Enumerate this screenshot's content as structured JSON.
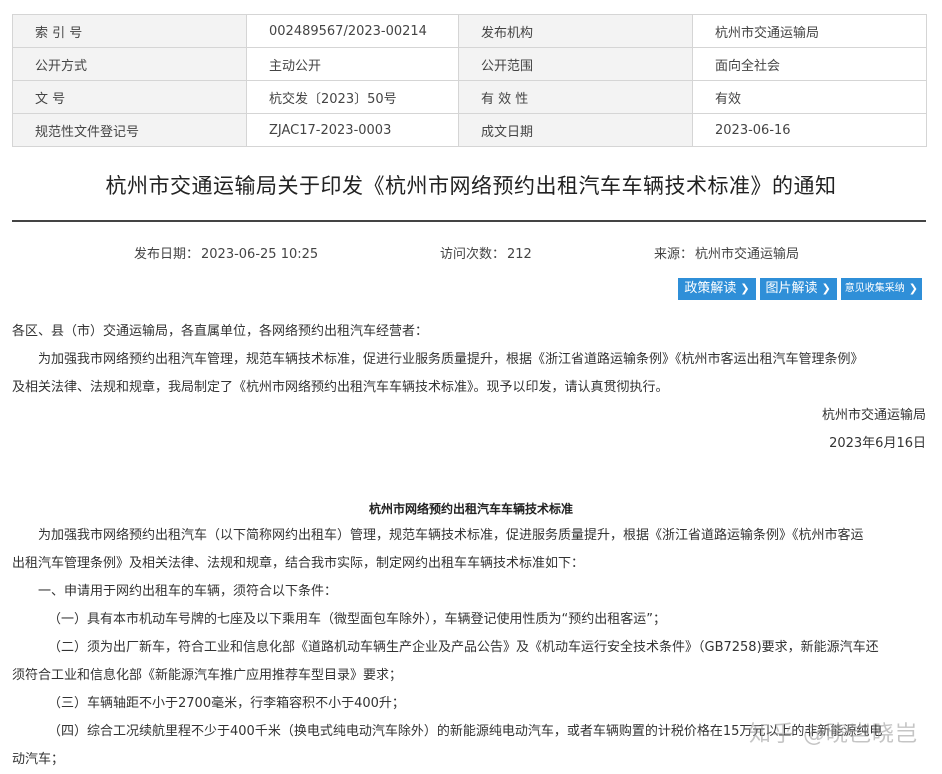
{
  "meta": {
    "rows": [
      [
        "索 引 号",
        "002489567/2023-00214",
        "发布机构",
        "杭州市交通运输局"
      ],
      [
        "公开方式",
        "主动公开",
        "公开范围",
        "面向全社会"
      ],
      [
        "文  号",
        "杭交发〔2023〕50号",
        "有 效 性",
        "有效"
      ],
      [
        "规范性文件登记号",
        "ZJAC17-2023-0003",
        "成文日期",
        "2023-06-16"
      ]
    ]
  },
  "article": {
    "title": "杭州市交通运输局关于印发《杭州市网络预约出租汽车车辆技术标准》的通知",
    "publish_label": "发布日期：",
    "publish_date": "2023-06-25 10:25",
    "visits_label": "访问次数：",
    "visits": "212",
    "source_label": "来源：",
    "source": "杭州市交通运输局"
  },
  "buttons": {
    "policy": "政策解读",
    "image": "图片解读",
    "feedback": "意见收集采纳"
  },
  "notice": {
    "salutation": "各区、县（市）交通运输局，各直属单位，各网络预约出租汽车经营者：",
    "line1": "为加强我市网络预约出租汽车管理，规范车辆技术标准，促进行业服务质量提升，根据《浙江省道路运输条例》《杭州市客运出租汽车管理条例》",
    "line2": "及相关法律、法规和规章，我局制定了《杭州市网络预约出租汽车车辆技术标准》。现予以印发，请认真贯彻执行。",
    "signature": "杭州市交通运输局",
    "date": "2023年6月16日"
  },
  "standard": {
    "title": "杭州市网络预约出租汽车车辆技术标准",
    "lines": [
      "为加强我市网络预约出租汽车（以下简称网约出租车）管理，规范车辆技术标准，促进服务质量提升，根据《浙江省道路运输条例》《杭州市客运",
      "出租汽车管理条例》及相关法律、法规和规章，结合我市实际，制定网约出租车车辆技术标准如下：",
      "一、申请用于网约出租车的车辆，须符合以下条件：",
      "（一）具有本市机动车号牌的七座及以下乘用车（微型面包车除外），车辆登记使用性质为“预约出租客运”；",
      "（二）须为出厂新车，符合工业和信息化部《道路机动车辆生产企业及产品公告》及《机动车运行安全技术条件》（GB7258)要求，新能源汽车还",
      "须符合工业和信息化部《新能源汽车推广应用推荐车型目录》要求；",
      "（三）车辆轴距不小于2700毫米，行李箱容积不小于400升；",
      "（四）综合工况续航里程不少于400千米（换电式纯电动汽车除外）的新能源纯电动汽车，或者车辆购置的计税价格在15万元以上的非新能源纯电",
      "动汽车；"
    ]
  },
  "watermark": "知乎 @晓岂晓岂"
}
